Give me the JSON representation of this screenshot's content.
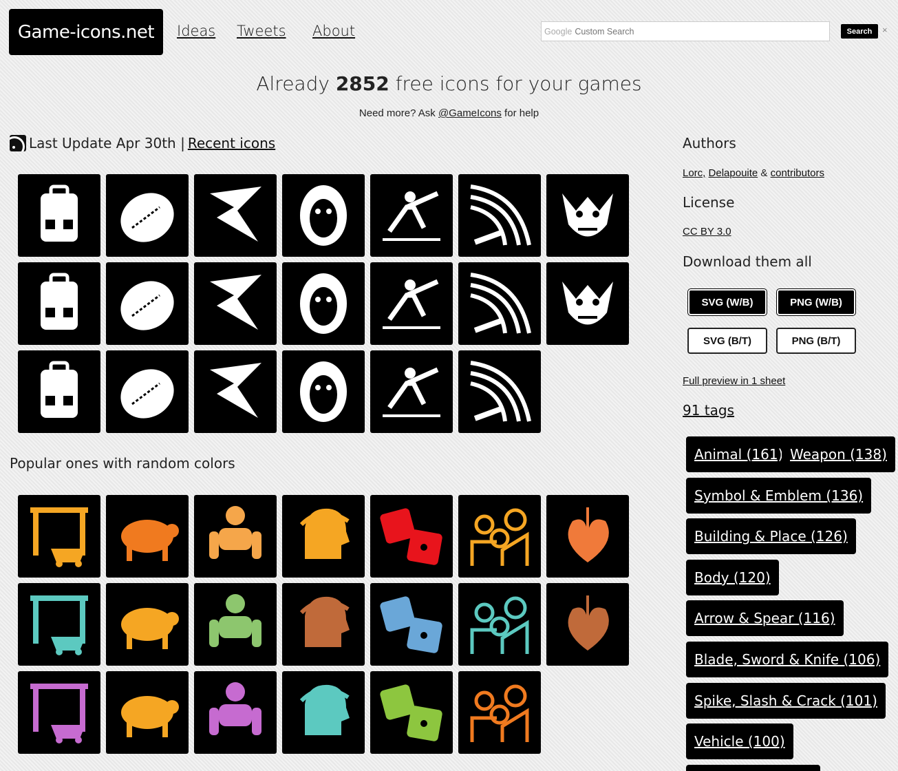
{
  "header": {
    "logo": "Game-icons.net",
    "nav": [
      "Ideas",
      "Tweets",
      "About"
    ],
    "search_brand": "Google",
    "search_placeholder": "Custom Search",
    "search_button": "Search",
    "search_clear": "×"
  },
  "hero": {
    "prefix": "Already ",
    "count": "2852",
    "suffix": " free icons for your games",
    "sub_prefix": "Need more? Ask ",
    "sub_link": "@GameIcons",
    "sub_suffix": " for help"
  },
  "update": {
    "text": "Last Update Apr 30th |",
    "link": "Recent icons"
  },
  "recent_icons": [
    {
      "name": "backpack-icon",
      "color": "#ffffff"
    },
    {
      "name": "lemon-icon",
      "color": "#ffffff"
    },
    {
      "name": "lightning-sword-icon",
      "color": "#ffffff"
    },
    {
      "name": "monkey-mask-icon",
      "color": "#ffffff"
    },
    {
      "name": "fencer-icon",
      "color": "#ffffff"
    },
    {
      "name": "sword-slash-icon",
      "color": "#ffffff"
    },
    {
      "name": "goblin-head-icon",
      "color": "#ffffff"
    },
    {
      "name": "scroll-ruler-icon",
      "color": "#ffffff"
    },
    {
      "name": "eye-lightning-icon",
      "color": "#ffffff"
    },
    {
      "name": "swiss-knife-icon",
      "color": "#ffffff"
    },
    {
      "name": "kremlin-icon",
      "color": "#ffffff"
    },
    {
      "name": "vampire-cape-icon",
      "color": "#ffffff"
    },
    {
      "name": "crossed-swords-shield-icon",
      "color": "#ffffff"
    },
    {
      "name": "saxophone-icon",
      "color": "#ffffff"
    },
    {
      "name": "eyeball-vortex-icon",
      "color": "#ffffff"
    },
    {
      "name": "dagger-hilt-icon",
      "color": "#ffffff"
    },
    {
      "name": "pirate-captain-icon",
      "color": "#ffffff"
    },
    {
      "name": "castle-ruins-icon",
      "color": "#ffffff"
    },
    {
      "name": "missile-launcher-icon",
      "color": "#ffffff"
    },
    {
      "name": "high-kick-icon",
      "color": "#ffffff"
    }
  ],
  "popular_title": "Popular ones with random colors",
  "popular_icons": [
    {
      "name": "mine-wagon-icon",
      "color": "#f5a623"
    },
    {
      "name": "pig-icon",
      "color": "#f07a1f"
    },
    {
      "name": "golem-icon",
      "color": "#f5a64a"
    },
    {
      "name": "caesar-laurel-icon",
      "color": "#f5a623"
    },
    {
      "name": "dice-icon",
      "color": "#e8141c"
    },
    {
      "name": "family-icon",
      "color": "#f5a623"
    },
    {
      "name": "leaf-icon",
      "color": "#f07a3a"
    },
    {
      "name": "gem-sun-icon",
      "color": "#5cc9c0"
    },
    {
      "name": "dinosaur-icon",
      "color": "#f5a623"
    },
    {
      "name": "horus-head-icon",
      "color": "#8dc66e"
    },
    {
      "name": "bullet-icon",
      "color": "#c06a3a"
    },
    {
      "name": "castle-night-icon",
      "color": "#6aa7d8"
    },
    {
      "name": "comet-icon",
      "color": "#5cc9c0"
    },
    {
      "name": "treasure-scroll-icon",
      "color": "#c06a3a"
    },
    {
      "name": "key-icon",
      "color": "#c66bd0"
    },
    {
      "name": "viking-helmet-icon",
      "color": "#f5a623"
    },
    {
      "name": "ship-wheel-icon",
      "color": "#c66bd0"
    },
    {
      "name": "viking-head-icon",
      "color": "#5cc9c0"
    },
    {
      "name": "alien-smile-icon",
      "color": "#8dc63f"
    },
    {
      "name": "swirl-orb-icon",
      "color": "#f07a1f"
    }
  ],
  "sidebar": {
    "authors_title": "Authors",
    "author1": "Lorc,",
    "author2": "Delapouite",
    "amp": "&",
    "author3": "contributors",
    "license_title": "License",
    "license": "CC BY 3.0",
    "download_title": "Download them all",
    "buttons": [
      "SVG (W/B)",
      "PNG (W/B)",
      "SVG (B/T)",
      "PNG (B/T)"
    ],
    "preview": "Full preview in 1 sheet",
    "tags_title": "91 tags"
  },
  "tags": [
    "Animal (161)",
    "Weapon (138)",
    "Symbol & Emblem (136)",
    "Building & Place (126)",
    "Body (120)",
    "Arrow & Spear (116)",
    "Blade, Sword & Knife (106)",
    "Spike, Slash & Crack (101)",
    "Vehicle (100)"
  ]
}
